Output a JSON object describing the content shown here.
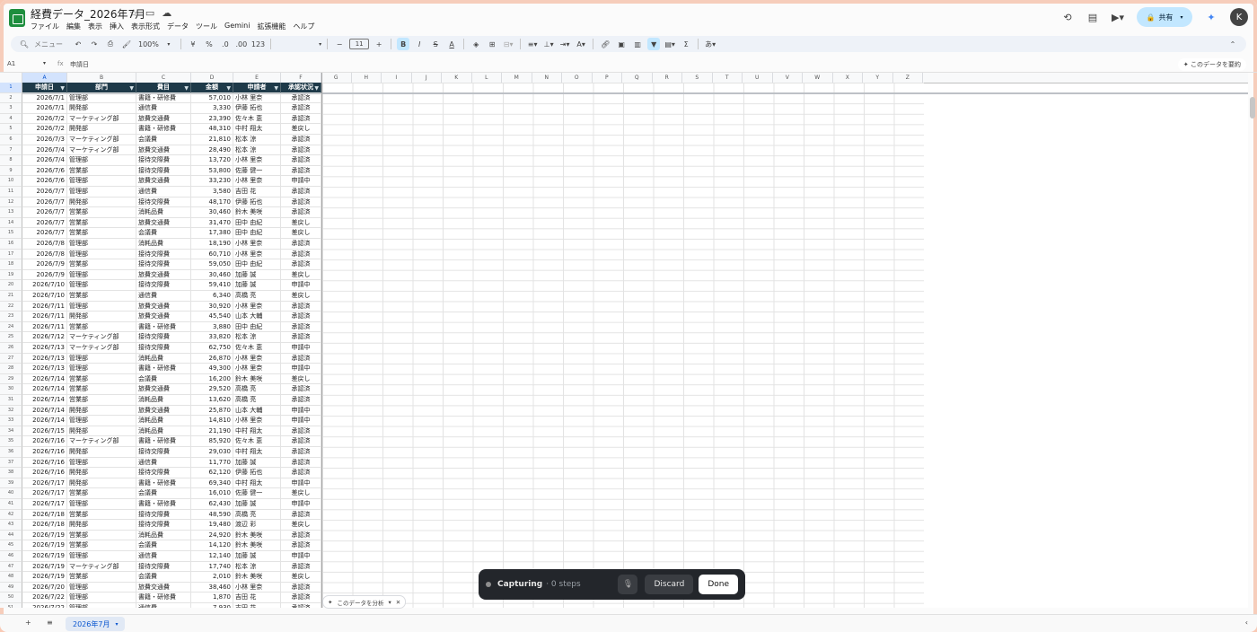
{
  "header": {
    "doc_title": "経費データ_2026年7月",
    "menu": [
      "ファイル",
      "編集",
      "表示",
      "挿入",
      "表示形式",
      "データ",
      "ツール",
      "Gemini",
      "拡張機能",
      "ヘルプ"
    ],
    "share_label": "共有",
    "avatar_initial": "K"
  },
  "toolbar": {
    "search_label": "メニュー",
    "zoom": "100%",
    "currency": "¥",
    "percent": "%",
    "dec_less": ".0",
    "dec_more": ".00",
    "number_format": "123",
    "font_size": "11"
  },
  "formula_bar": {
    "cell_ref": "A1",
    "content": "申請日",
    "summarize_label": "このデータを要約"
  },
  "columns": [
    "A",
    "B",
    "C",
    "D",
    "E",
    "F",
    "G",
    "H",
    "I",
    "J",
    "K",
    "L",
    "M",
    "N",
    "O",
    "P",
    "Q",
    "R",
    "S",
    "T",
    "U",
    "V",
    "W",
    "X",
    "Y",
    "Z"
  ],
  "table": {
    "headers": [
      "申請日",
      "部門",
      "費目",
      "金額",
      "申請者",
      "承認状況"
    ],
    "rows": [
      [
        "2026/7/1",
        "管理部",
        "書籍・研修費",
        "57,010",
        "小林 里奈",
        "承認済"
      ],
      [
        "2026/7/1",
        "開発部",
        "通信費",
        "3,330",
        "伊藤 拓也",
        "承認済"
      ],
      [
        "2026/7/2",
        "マーケティング部",
        "旅費交通費",
        "23,390",
        "佐々木 恵",
        "承認済"
      ],
      [
        "2026/7/2",
        "開発部",
        "書籍・研修費",
        "48,310",
        "中村 翔太",
        "差戻し"
      ],
      [
        "2026/7/3",
        "マーケティング部",
        "会議費",
        "21,810",
        "松本 涼",
        "承認済"
      ],
      [
        "2026/7/4",
        "マーケティング部",
        "旅費交通費",
        "28,490",
        "松本 涼",
        "承認済"
      ],
      [
        "2026/7/4",
        "管理部",
        "接待交際費",
        "13,720",
        "小林 里奈",
        "承認済"
      ],
      [
        "2026/7/6",
        "営業部",
        "接待交際費",
        "53,800",
        "佐藤 健一",
        "承認済"
      ],
      [
        "2026/7/6",
        "管理部",
        "旅費交通費",
        "33,230",
        "小林 里奈",
        "申請中"
      ],
      [
        "2026/7/7",
        "管理部",
        "通信費",
        "3,580",
        "吉田 花",
        "承認済"
      ],
      [
        "2026/7/7",
        "開発部",
        "接待交際費",
        "48,170",
        "伊藤 拓也",
        "承認済"
      ],
      [
        "2026/7/7",
        "営業部",
        "消耗品費",
        "30,460",
        "鈴木 美咲",
        "承認済"
      ],
      [
        "2026/7/7",
        "営業部",
        "旅費交通費",
        "31,470",
        "田中 由紀",
        "差戻し"
      ],
      [
        "2026/7/7",
        "営業部",
        "会議費",
        "17,380",
        "田中 由紀",
        "差戻し"
      ],
      [
        "2026/7/8",
        "管理部",
        "消耗品費",
        "18,190",
        "小林 里奈",
        "承認済"
      ],
      [
        "2026/7/8",
        "管理部",
        "接待交際費",
        "60,710",
        "小林 里奈",
        "承認済"
      ],
      [
        "2026/7/9",
        "営業部",
        "接待交際費",
        "59,050",
        "田中 由紀",
        "承認済"
      ],
      [
        "2026/7/9",
        "管理部",
        "旅費交通費",
        "30,460",
        "加藤 誠",
        "差戻し"
      ],
      [
        "2026/7/10",
        "管理部",
        "接待交際費",
        "59,410",
        "加藤 誠",
        "申請中"
      ],
      [
        "2026/7/10",
        "営業部",
        "通信費",
        "6,340",
        "高橋 亮",
        "差戻し"
      ],
      [
        "2026/7/11",
        "管理部",
        "旅費交通費",
        "30,920",
        "小林 里奈",
        "承認済"
      ],
      [
        "2026/7/11",
        "開発部",
        "旅費交通費",
        "45,540",
        "山本 大輔",
        "承認済"
      ],
      [
        "2026/7/11",
        "営業部",
        "書籍・研修費",
        "3,880",
        "田中 由紀",
        "承認済"
      ],
      [
        "2026/7/12",
        "マーケティング部",
        "接待交際費",
        "33,820",
        "松本 涼",
        "承認済"
      ],
      [
        "2026/7/13",
        "マーケティング部",
        "接待交際費",
        "62,750",
        "佐々木 恵",
        "申請中"
      ],
      [
        "2026/7/13",
        "管理部",
        "消耗品費",
        "26,870",
        "小林 里奈",
        "承認済"
      ],
      [
        "2026/7/13",
        "管理部",
        "書籍・研修費",
        "49,300",
        "小林 里奈",
        "申請中"
      ],
      [
        "2026/7/14",
        "営業部",
        "会議費",
        "16,200",
        "鈴木 美咲",
        "差戻し"
      ],
      [
        "2026/7/14",
        "営業部",
        "旅費交通費",
        "29,520",
        "高橋 亮",
        "承認済"
      ],
      [
        "2026/7/14",
        "営業部",
        "消耗品費",
        "13,620",
        "高橋 亮",
        "承認済"
      ],
      [
        "2026/7/14",
        "開発部",
        "旅費交通費",
        "25,870",
        "山本 大輔",
        "申請中"
      ],
      [
        "2026/7/14",
        "管理部",
        "消耗品費",
        "14,810",
        "小林 里奈",
        "申請中"
      ],
      [
        "2026/7/15",
        "開発部",
        "消耗品費",
        "21,190",
        "中村 翔太",
        "承認済"
      ],
      [
        "2026/7/16",
        "マーケティング部",
        "書籍・研修費",
        "85,920",
        "佐々木 恵",
        "承認済"
      ],
      [
        "2026/7/16",
        "開発部",
        "接待交際費",
        "29,030",
        "中村 翔太",
        "承認済"
      ],
      [
        "2026/7/16",
        "管理部",
        "通信費",
        "11,770",
        "加藤 誠",
        "承認済"
      ],
      [
        "2026/7/16",
        "開発部",
        "接待交際費",
        "62,120",
        "伊藤 拓也",
        "承認済"
      ],
      [
        "2026/7/17",
        "開発部",
        "書籍・研修費",
        "69,340",
        "中村 翔太",
        "申請中"
      ],
      [
        "2026/7/17",
        "営業部",
        "会議費",
        "16,010",
        "佐藤 健一",
        "差戻し"
      ],
      [
        "2026/7/17",
        "管理部",
        "書籍・研修費",
        "62,430",
        "加藤 誠",
        "申請中"
      ],
      [
        "2026/7/18",
        "営業部",
        "接待交際費",
        "48,590",
        "高橋 亮",
        "承認済"
      ],
      [
        "2026/7/18",
        "開発部",
        "接待交際費",
        "19,480",
        "渡辺 彩",
        "差戻し"
      ],
      [
        "2026/7/19",
        "営業部",
        "消耗品費",
        "24,920",
        "鈴木 美咲",
        "承認済"
      ],
      [
        "2026/7/19",
        "営業部",
        "会議費",
        "14,120",
        "鈴木 美咲",
        "承認済"
      ],
      [
        "2026/7/19",
        "管理部",
        "通信費",
        "12,140",
        "加藤 誠",
        "申請中"
      ],
      [
        "2026/7/19",
        "マーケティング部",
        "接待交際費",
        "17,740",
        "松本 涼",
        "承認済"
      ],
      [
        "2026/7/19",
        "営業部",
        "会議費",
        "2,010",
        "鈴木 美咲",
        "差戻し"
      ],
      [
        "2026/7/20",
        "管理部",
        "旅費交通費",
        "38,460",
        "小林 里奈",
        "承認済"
      ],
      [
        "2026/7/22",
        "管理部",
        "書籍・研修費",
        "1,870",
        "吉田 花",
        "承認済"
      ],
      [
        "2026/7/22",
        "管理部",
        "通信費",
        "7,930",
        "吉田 花",
        "承認済"
      ]
    ]
  },
  "explore_chip": {
    "label": "このデータを分析"
  },
  "capture": {
    "status": "Capturing",
    "steps": "· 0 steps",
    "discard_label": "Discard",
    "done_label": "Done"
  },
  "sheet": {
    "tab_name": "2026年7月"
  }
}
